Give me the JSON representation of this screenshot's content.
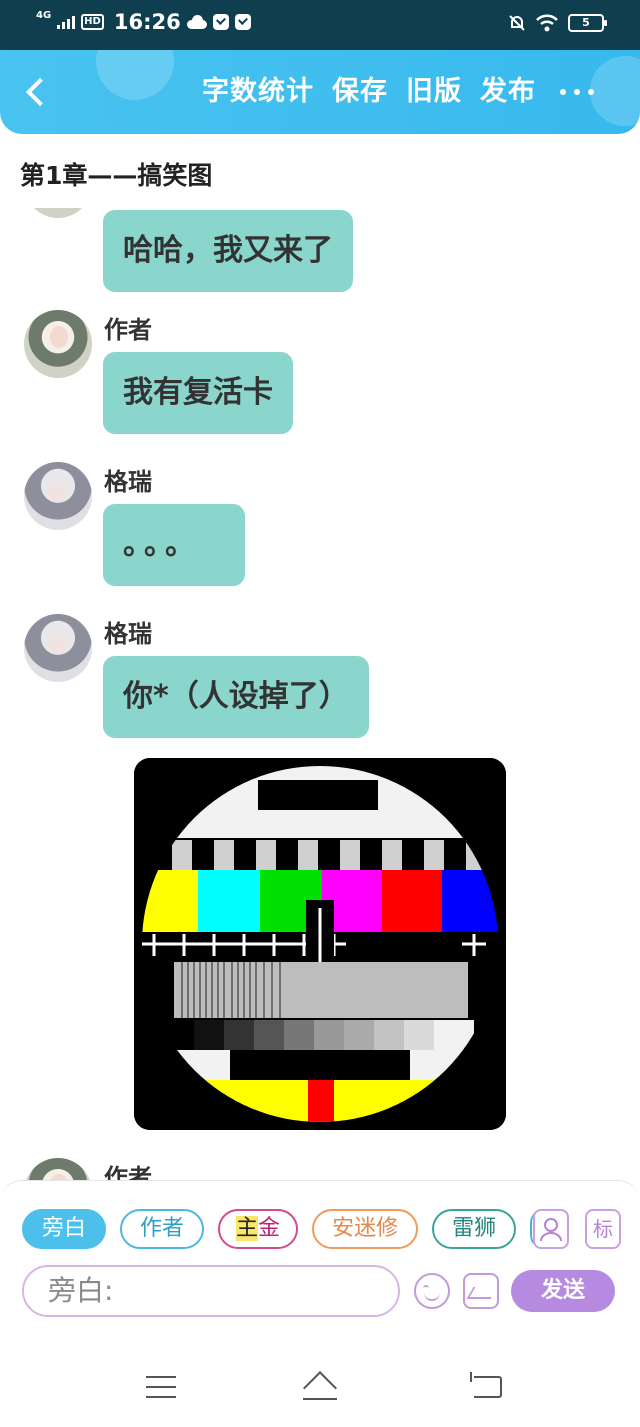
{
  "status_bar": {
    "network": "4G",
    "hd": "HD",
    "time": "16:26",
    "battery": "5"
  },
  "header": {
    "actions": [
      "字数统计",
      "保存",
      "旧版",
      "发布"
    ]
  },
  "chapter": {
    "title": "第1章——搞笑图"
  },
  "messages": [
    {
      "sender": "",
      "text": "哈哈，我又来了"
    },
    {
      "sender": "作者",
      "text": "我有复活卡"
    },
    {
      "sender": "格瑞",
      "text": "。。。"
    },
    {
      "sender": "格瑞",
      "text": "你*（人设掉了）"
    },
    {
      "sender": "作者",
      "text": ""
    }
  ],
  "image_message": {
    "description_icon": "tv-test-card-icon"
  },
  "roles": {
    "narration": "旁白",
    "author": "作者",
    "main_prefix": "主",
    "main_suffix": "金",
    "amx": "安迷修",
    "lion": "雷狮",
    "tag_label": "标"
  },
  "input": {
    "placeholder": "旁白:",
    "send_label": "发送"
  },
  "colors": {
    "header": "#49c3ef",
    "bubble": "#8ad6cc",
    "send": "#b58ae0"
  }
}
